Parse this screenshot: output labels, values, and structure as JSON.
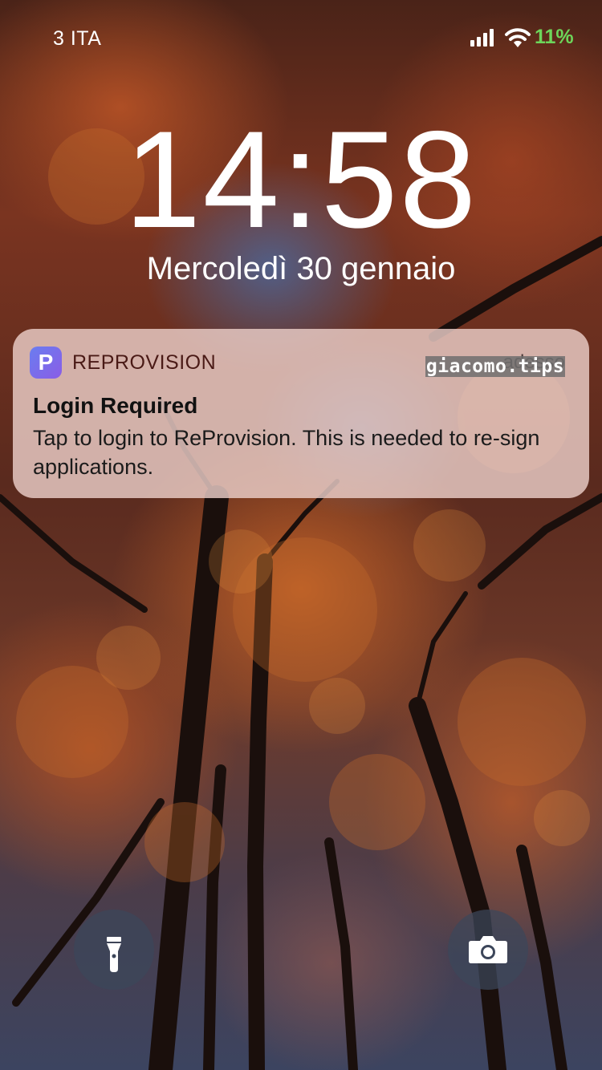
{
  "status_bar": {
    "carrier": "3 ITA",
    "battery_percent": "11%",
    "signal_icon": "cellular-signal-icon",
    "wifi_icon": "wifi-icon",
    "battery_color": "#6dd65a"
  },
  "lock_screen": {
    "time": "14:58",
    "date": "Mercoledì 30 gennaio"
  },
  "notification": {
    "app_name": "REPROVISION",
    "app_icon_letter": "P",
    "time_label": "adesso",
    "watermark": "giacomo.tips",
    "title": "Login Required",
    "body": "Tap to login to ReProvision. This is needed to re-sign applications."
  },
  "quick_actions": {
    "flashlight_icon": "flashlight-icon",
    "camera_icon": "camera-icon"
  }
}
